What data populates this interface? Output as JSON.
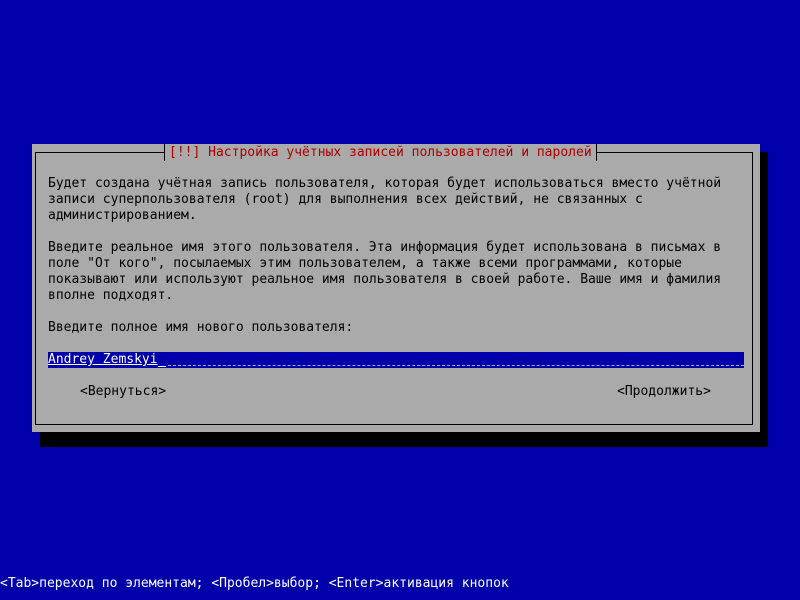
{
  "colors": {
    "background": "#0000aa",
    "dialog": "#aaaaaa",
    "title": "#aa0000",
    "input_bg": "#0000aa",
    "input_text": "#ffffff"
  },
  "dialog": {
    "title": "[!!] Настройка учётных записей пользователей и паролей",
    "paragraph1": "Будет создана учётная запись пользователя, которая будет использоваться вместо учётной\nзаписи суперпользователя (root) для выполнения всех действий, не связанных с\nадминистрированием.",
    "paragraph2": "Введите реальное имя этого пользователя. Эта информация будет использована в письмах в\nполе \"От кого\", посылаемых этим пользователем, а также всеми программами, которые\nпоказывают или используют реальное имя пользователя в своей работе. Ваше имя и фамилия\nвполне подходят.",
    "prompt": "Введите полное имя нового пользователя:",
    "input_value": "Andrey Zemskyi",
    "back_label": "<Вернуться>",
    "continue_label": "<Продолжить>"
  },
  "statusbar": {
    "text": "<Tab>переход по элементам; <Пробел>выбор; <Enter>активация кнопок"
  }
}
